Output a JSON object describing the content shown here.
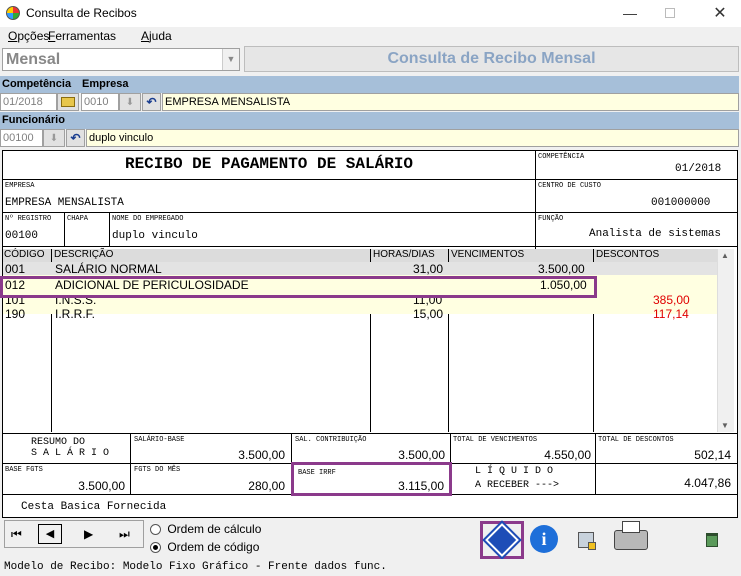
{
  "window": {
    "title": "Consulta de Recibos"
  },
  "menu": {
    "items": [
      "Opções",
      "Ferramentas",
      "Ajuda"
    ],
    "underline": [
      "O",
      "F",
      "A"
    ]
  },
  "topbar": {
    "mode_value": "Mensal",
    "header_title": "Consulta de Recibo Mensal"
  },
  "filters": {
    "competencia_label": "Competência",
    "empresa_label": "Empresa",
    "competencia_value": "01/2018",
    "empresa_code": "0010",
    "empresa_name": "EMPRESA MENSALISTA",
    "funcionario_label": "Funcionário",
    "funcionario_code": "00100",
    "funcionario_name": "duplo vinculo"
  },
  "receipt": {
    "title": "RECIBO DE PAGAMENTO DE SALÁRIO",
    "competencia_label": "COMPETÊNCIA",
    "competencia_value": "01/2018",
    "empresa_label": "EMPRESA",
    "empresa_value": "EMPRESA MENSALISTA",
    "centro_custo_label": "CENTRO DE CUSTO",
    "centro_custo_value": "001000000",
    "registro_label": "Nº REGISTRO",
    "registro_value": "00100",
    "chapa_label": "CHAPA",
    "chapa_value": "",
    "nome_label": "NOME DO EMPREGADO",
    "nome_value": "duplo vinculo",
    "funcao_label": "FUNÇÃO",
    "funcao_value": "Analista de sistemas"
  },
  "grid": {
    "headers": [
      "CÓDIGO",
      "DESCRIÇÃO",
      "HORAS/DIAS",
      "VENCIMENTOS",
      "DESCONTOS"
    ],
    "rows": [
      {
        "codigo": "001",
        "descricao": "SALÁRIO NORMAL",
        "horas": "31,00",
        "vencimentos": "3.500,00",
        "descontos": ""
      },
      {
        "codigo": "012",
        "descricao": "ADICIONAL DE PERICULOSIDADE",
        "horas": "",
        "vencimentos": "1.050,00",
        "descontos": ""
      },
      {
        "codigo": "101",
        "descricao": "I.N.S.S.",
        "horas": "11,00",
        "vencimentos": "",
        "descontos": "385,00"
      },
      {
        "codigo": "190",
        "descricao": "I.R.R.F.",
        "horas": "15,00",
        "vencimentos": "",
        "descontos": "117,14"
      }
    ]
  },
  "summary": {
    "resumo_line1": "RESUMO DO",
    "resumo_line2": "S A L Á R I O",
    "salario_base_label": "SALÁRIO-BASE",
    "salario_base_value": "3.500,00",
    "sal_contrib_label": "SAL. CONTRIBUIÇÃO",
    "sal_contrib_value": "3.500,00",
    "total_venc_label": "TOTAL DE VENCIMENTOS",
    "total_venc_value": "4.550,00",
    "total_desc_label": "TOTAL DE DESCONTOS",
    "total_desc_value": "502,14",
    "base_fgts_label": "BASE FGTS",
    "base_fgts_value": "3.500,00",
    "fgts_mes_label": "FGTS DO MÊS",
    "fgts_mes_value": "280,00",
    "base_irrf_label": "BASE IRRF",
    "base_irrf_value": "3.115,00",
    "liquido_line1": "L Í Q U I D O",
    "liquido_line2": "A RECEBER --->",
    "liquido_value": "4.047,86",
    "footer_note": "Cesta Basica Fornecida"
  },
  "order": {
    "option1": "Ordem de cálculo",
    "option2": "Ordem de código",
    "selected": "option2"
  },
  "statusbar": {
    "text": "Modelo de Recibo: Modelo Fixo Gráfico - Frente dados func."
  },
  "colors": {
    "highlight": "#8b3a8b",
    "header_bar": "#a6bfd9",
    "discount_red": "#e00000",
    "title_blue": "#8aa4c4"
  }
}
